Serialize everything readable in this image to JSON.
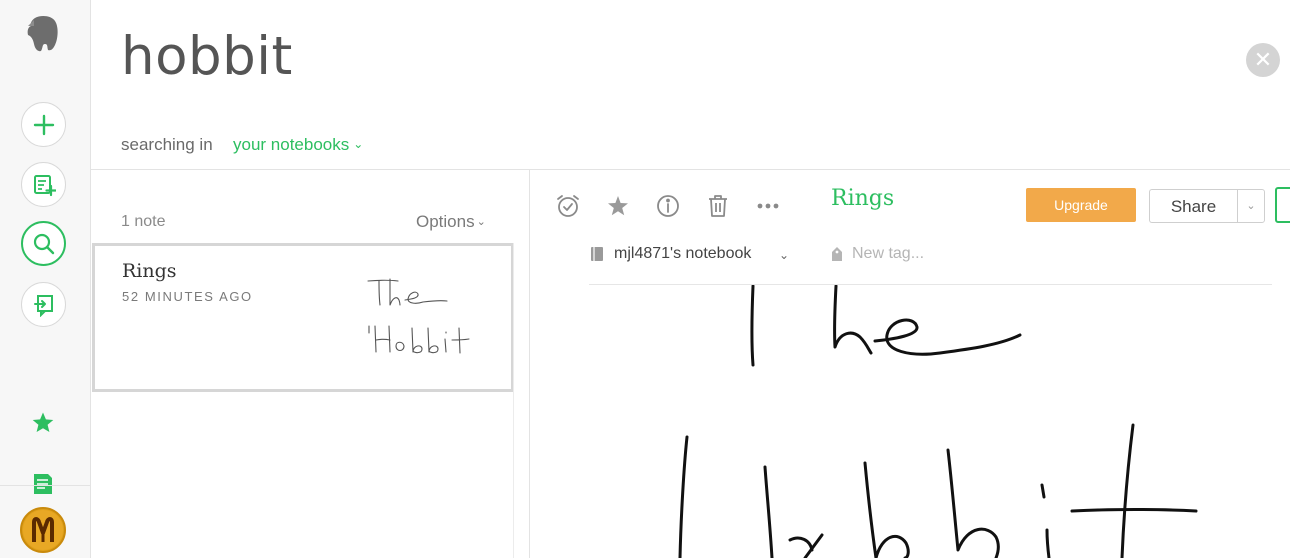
{
  "colors": {
    "accent": "#2dbe60",
    "upgrade": "#f2a94a",
    "text": "#4a4a4a",
    "muted": "#8a8a8a"
  },
  "rail": {
    "icons": [
      "elephant-logo-icon",
      "plus-icon",
      "new-note-icon",
      "search-icon",
      "work-chat-icon",
      "star-icon",
      "notes-icon",
      "avatar"
    ],
    "avatar_letter": "M"
  },
  "search": {
    "query": "hobbit",
    "searching_in_label": "searching in",
    "scope": "your notebooks",
    "scope_chevron": "⌄",
    "close_glyph": "✕"
  },
  "list": {
    "count": "1 note",
    "options_label": "Options",
    "options_chevron": "⌄",
    "notes": [
      {
        "title": "Rings",
        "time": "52 MINUTES AGO"
      }
    ]
  },
  "editor": {
    "toolbar_icons": [
      "reminder-icon",
      "shortcut-star-icon",
      "info-icon",
      "trash-icon",
      "more-icon"
    ],
    "title": "Rings",
    "upgrade_label": "Upgrade",
    "share_label": "Share",
    "share_chevron": "⌄",
    "notebook": "mjl4871's notebook",
    "notebook_chevron": "⌄",
    "tag_placeholder": "New tag..."
  }
}
